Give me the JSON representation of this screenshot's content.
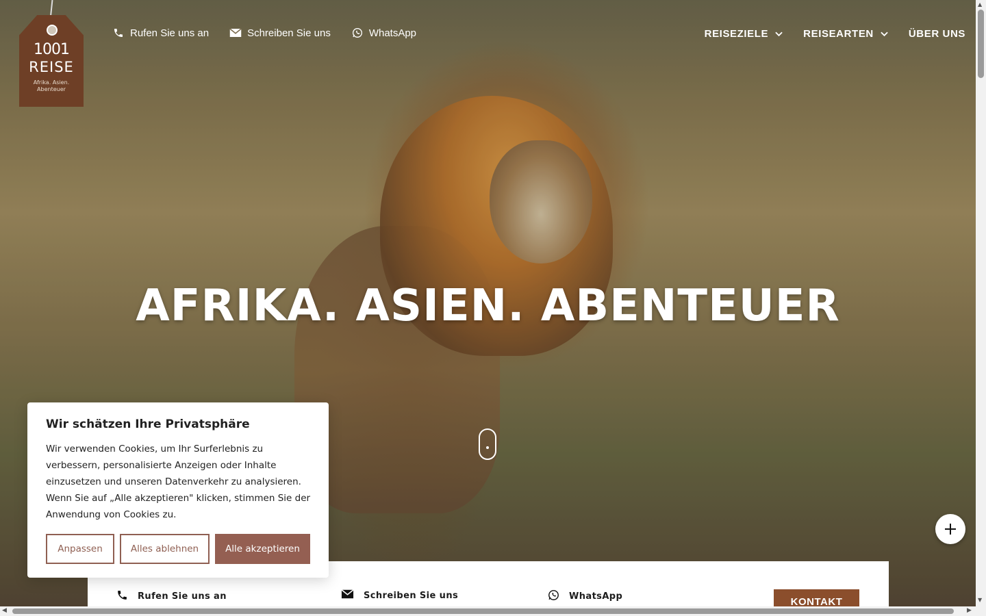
{
  "logo": {
    "line1": "1001",
    "line2": "REISE",
    "tagline": "Afrika. Asien. Abenteuer"
  },
  "top_links": [
    {
      "label": "Rufen Sie uns an",
      "icon": "phone-icon"
    },
    {
      "label": "Schreiben Sie uns",
      "icon": "mail-icon"
    },
    {
      "label": "WhatsApp",
      "icon": "whatsapp-icon"
    }
  ],
  "nav": [
    {
      "label": "REISEZIELE",
      "has_dropdown": true
    },
    {
      "label": "REISEARTEN",
      "has_dropdown": true
    },
    {
      "label": "ÜBER UNS",
      "has_dropdown": false
    }
  ],
  "hero": {
    "headline": "AFRIKA. ASIEN. ABENTEUER"
  },
  "cookie": {
    "title": "Wir schätzen Ihre Privatsphäre",
    "text": "Wir verwenden Cookies, um Ihr Surferlebnis zu verbessern, personalisierte Anzeigen oder Inhalte einzusetzen und unseren Datenverkehr zu analysieren. Wenn Sie auf „Alle akzeptieren\" klicken, stimmen Sie der Anwendung von Cookies zu.",
    "customize": "Anpassen",
    "reject": "Alles ablehnen",
    "accept": "Alle akzeptieren"
  },
  "bottom_bar": {
    "call": "Rufen Sie uns an",
    "write": "Schreiben Sie uns",
    "whatsapp": "WhatsApp",
    "contact": "KONTAKT"
  },
  "colors": {
    "brand_brown": "#8b4e2c",
    "cookie_accent": "#945f52",
    "text_dark": "#212121"
  }
}
